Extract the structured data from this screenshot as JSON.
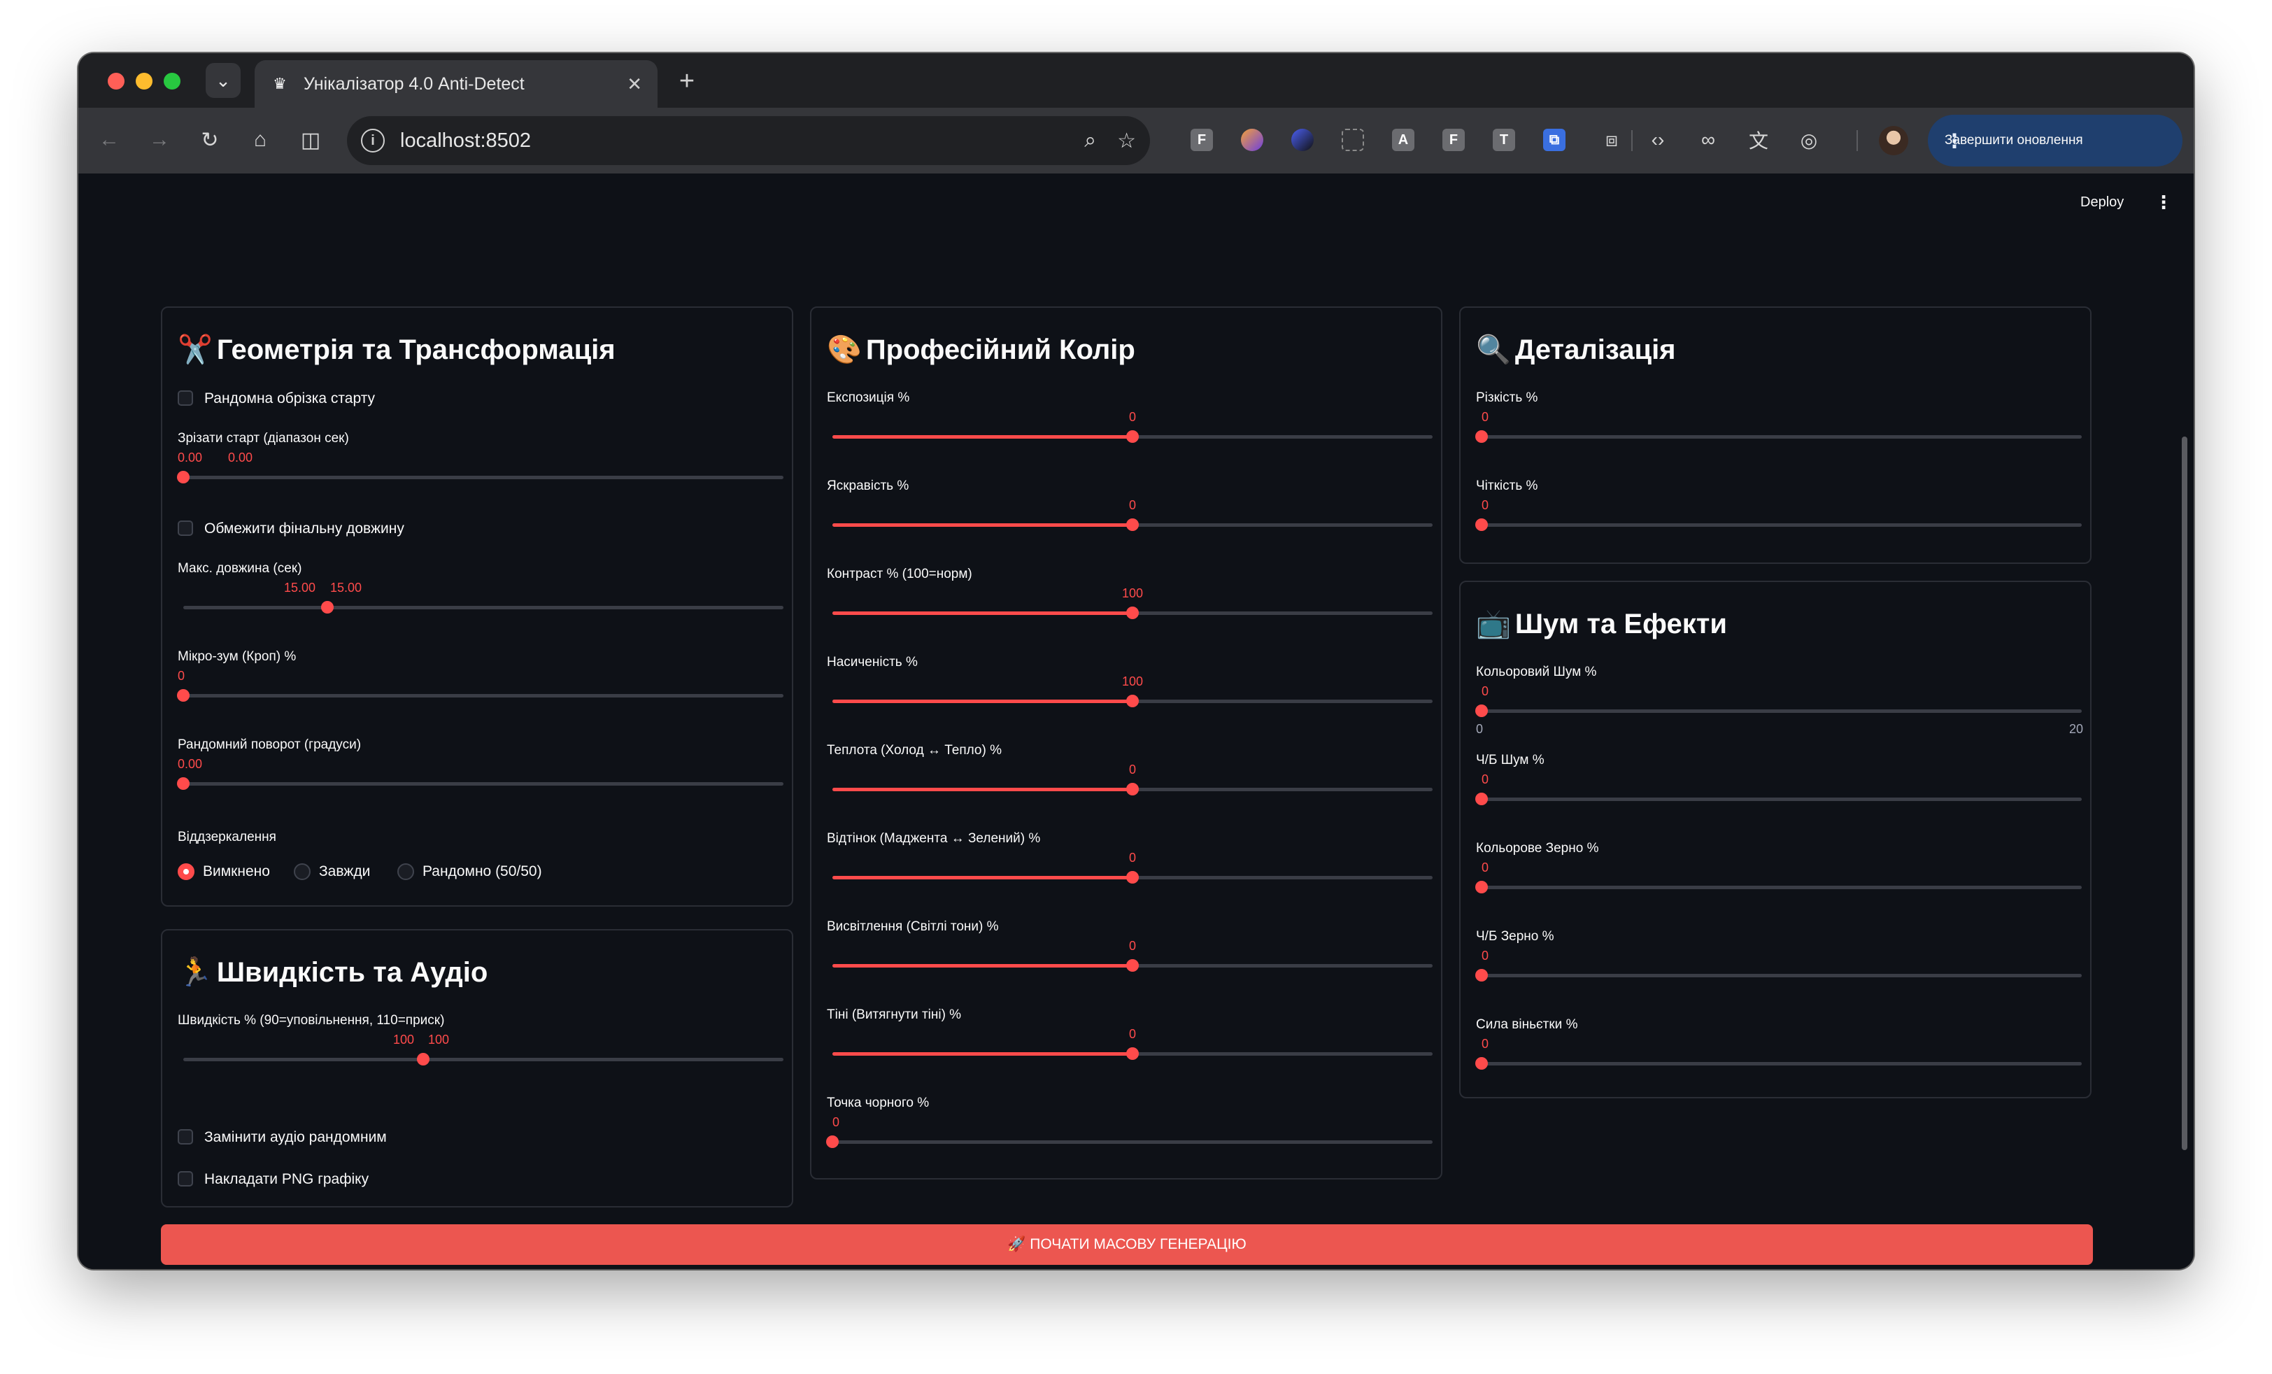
{
  "browser": {
    "tab_title": "Унікалізатор 4.0 Anti-Detect",
    "url": "localhost:8502",
    "update_button": "Завершити оновлення",
    "extensions": [
      "F",
      "A",
      "F",
      "T"
    ]
  },
  "app": {
    "deploy_label": "Deploy",
    "run_button": "🚀 ПОЧАТИ МАСОВУ ГЕНЕРАЦІЮ"
  },
  "geometry": {
    "title_emoji": "✂️",
    "title": "Геометрія та Трансформація",
    "random_crop_label": "Рандомна обрізка старту",
    "random_crop_checked": false,
    "trim_start": {
      "label": "Зрізати старт (діапазон сек)",
      "low": "0.00",
      "high": "0.00",
      "fraction": 0
    },
    "limit_length_label": "Обмежити фінальну довжину",
    "limit_length_checked": false,
    "max_length": {
      "label": "Макс. довжина (сек)",
      "low": "15.00",
      "high": "15.00",
      "fraction": 0.24
    },
    "micro_zoom": {
      "label": "Мікро-зум (Кроп) %",
      "value": "0",
      "fraction": 0
    },
    "rotation": {
      "label": "Рандомний поворот (градуси)",
      "value": "0.00",
      "fraction": 0
    },
    "mirror_label": "Віддзеркалення",
    "mirror_options": [
      "Вимкнено",
      "Завжди",
      "Рандомно (50/50)"
    ],
    "mirror_selected": "Вимкнено"
  },
  "speed": {
    "title_emoji": "🏃",
    "title": "Швидкість та Аудіо",
    "speed_slider": {
      "label": "Швидкість % (90=уповільнення, 110=приск)",
      "low": "100",
      "high": "100",
      "fraction": 0.4
    },
    "replace_audio_label": "Замінити аудіо рандомним",
    "replace_audio_checked": false,
    "overlay_png_label": "Накладати PNG графіку",
    "overlay_png_checked": false
  },
  "color": {
    "title_emoji": "🎨",
    "title": "Професійний Колір",
    "sliders": [
      {
        "label": "Експозиція %",
        "value": "0",
        "fraction": 0.5
      },
      {
        "label": "Яскравість %",
        "value": "0",
        "fraction": 0.5
      },
      {
        "label": "Контраст % (100=норм)",
        "value": "100",
        "fraction": 0.5
      },
      {
        "label": "Насиченість %",
        "value": "100",
        "fraction": 0.5
      },
      {
        "label": "Теплота (Холод ↔ Тепло) %",
        "value": "0",
        "fraction": 0.5
      },
      {
        "label": "Відтінок (Маджента ↔ Зелений) %",
        "value": "0",
        "fraction": 0.5
      },
      {
        "label": "Висвітлення (Світлі тони) %",
        "value": "0",
        "fraction": 0.5
      },
      {
        "label": "Тіні (Витягнути тіні) %",
        "value": "0",
        "fraction": 0.5
      },
      {
        "label": "Точка чорного %",
        "value": "0",
        "fraction": 0
      }
    ]
  },
  "detail": {
    "title_emoji": "🔍",
    "title": "Деталізація",
    "sliders": [
      {
        "label": "Різкість %",
        "value": "0",
        "fraction": 0
      },
      {
        "label": "Чіткість %",
        "value": "0",
        "fraction": 0
      }
    ]
  },
  "noise": {
    "title_emoji": "📺",
    "title": "Шум та Ефекти",
    "sliders": [
      {
        "label": "Кольоровий Шум %",
        "value": "0",
        "fraction": 0,
        "min": "0",
        "max": "20"
      },
      {
        "label": "Ч/Б Шум %",
        "value": "0",
        "fraction": 0
      },
      {
        "label": "Кольорове Зерно %",
        "value": "0",
        "fraction": 0
      },
      {
        "label": "Ч/Б Зерно %",
        "value": "0",
        "fraction": 0
      },
      {
        "label": "Сила віньєтки %",
        "value": "0",
        "fraction": 0
      }
    ]
  }
}
